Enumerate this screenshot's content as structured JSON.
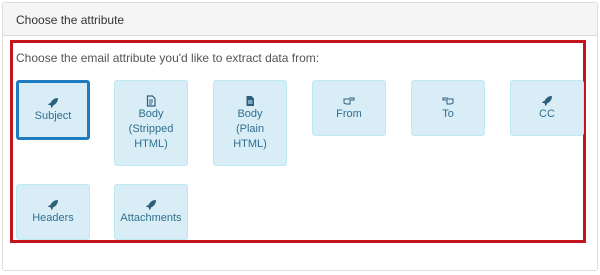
{
  "panel": {
    "heading": "Choose the attribute",
    "instruction": "Choose the email attribute you'd like to extract data from:"
  },
  "attributes": [
    {
      "label": "Subject",
      "icon": "rocket-icon",
      "selected": true
    },
    {
      "label": "Body (Stripped HTML)",
      "icon": "file-icon",
      "selected": false
    },
    {
      "label": "Body (Plain HTML)",
      "icon": "file-text-icon",
      "selected": false
    },
    {
      "label": "From",
      "icon": "hand-right-icon",
      "selected": false
    },
    {
      "label": "To",
      "icon": "hand-left-icon",
      "selected": false
    },
    {
      "label": "CC",
      "icon": "rocket-icon",
      "selected": false
    },
    {
      "label": "Headers",
      "icon": "rocket-icon",
      "selected": false
    },
    {
      "label": "Attachments",
      "icon": "rocket-icon",
      "selected": false
    }
  ],
  "colors": {
    "tile_bg": "#d9edf7",
    "tile_text": "#31708f",
    "selected_border": "#1f7bbf",
    "highlight_border": "#c4141e"
  }
}
